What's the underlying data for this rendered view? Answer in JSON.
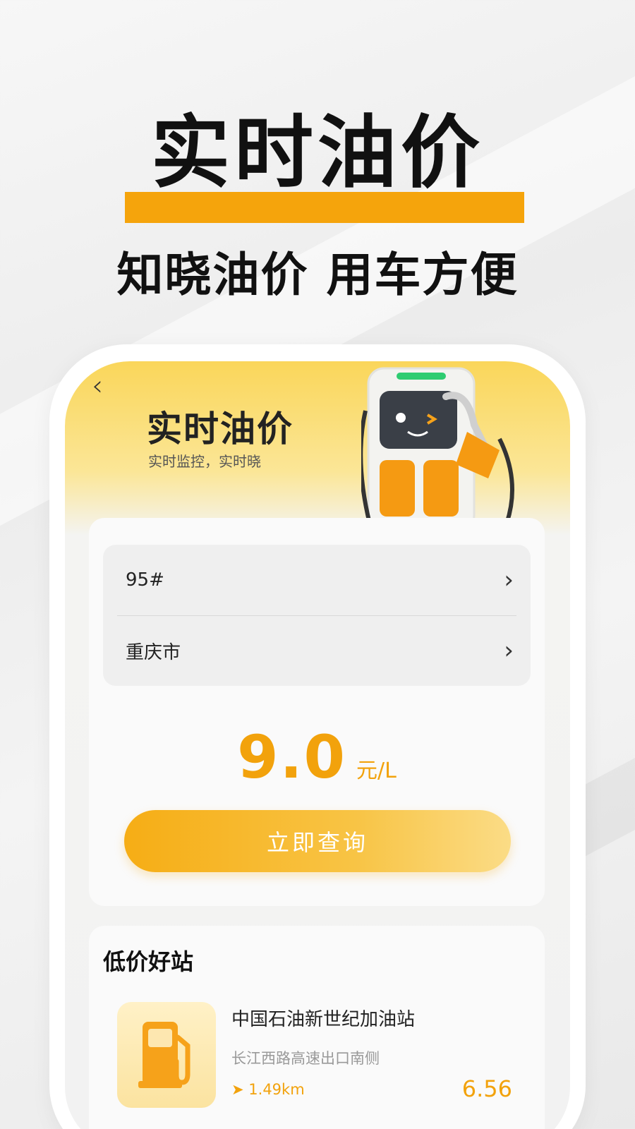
{
  "promo": {
    "title": "实时油价",
    "subtitle": "知晓油价 用车方便"
  },
  "screen": {
    "back_icon": "chevron-left-icon",
    "title": "实时油价",
    "subtitle": "实时监控，实时晓"
  },
  "selector": {
    "fuel_type": "95#",
    "city": "重庆市"
  },
  "price": {
    "value": "9.0",
    "unit": "元/L"
  },
  "query_button": "立即查询",
  "list": {
    "title": "低价好站",
    "stations": [
      {
        "name": "中国石油新世纪加油站",
        "address": "长江西路高速出口南侧",
        "distance": "1.49km",
        "price": "6.56"
      }
    ]
  },
  "colors": {
    "accent": "#f2a20c",
    "promo_underline": "#f5a40c",
    "header_yellow": "#fad65a"
  }
}
